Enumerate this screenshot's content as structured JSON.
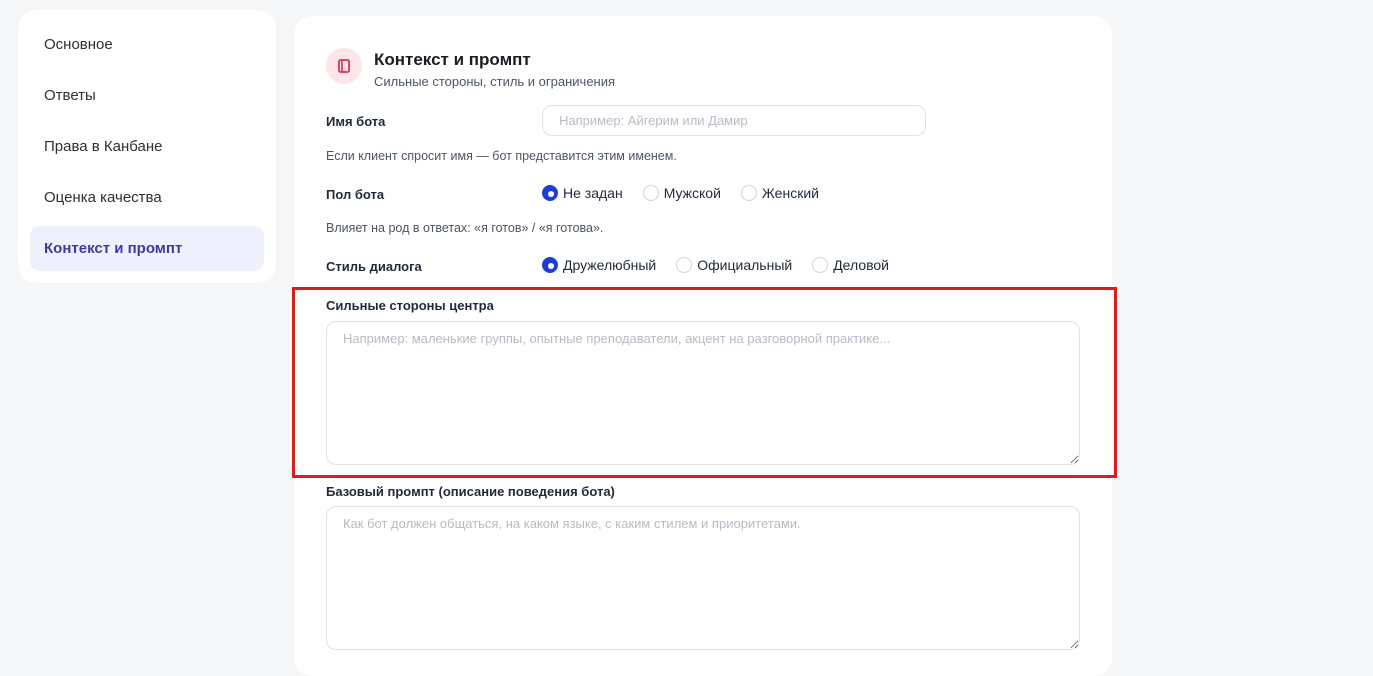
{
  "sidebar": {
    "items": [
      {
        "label": "Основное",
        "active": false
      },
      {
        "label": "Ответы",
        "active": false
      },
      {
        "label": "Права в Канбане",
        "active": false
      },
      {
        "label": "Оценка качества",
        "active": false
      },
      {
        "label": "Контекст и промпт",
        "active": true
      }
    ]
  },
  "section": {
    "icon": "book-icon",
    "title": "Контекст и промпт",
    "subtitle": "Сильные стороны, стиль и ограничения"
  },
  "bot_name": {
    "label": "Имя бота",
    "value": "",
    "placeholder": "Например: Айгерим или Дамир",
    "hint": "Если клиент спросит имя — бот представится этим именем."
  },
  "bot_gender": {
    "label": "Пол бота",
    "options": [
      "Не задан",
      "Мужской",
      "Женский"
    ],
    "selected": "Не задан",
    "hint": "Влияет на род в ответах: «я готов» / «я готова»."
  },
  "dialog_style": {
    "label": "Стиль диалога",
    "options": [
      "Дружелюбный",
      "Официальный",
      "Деловой"
    ],
    "selected": "Дружелюбный"
  },
  "strengths": {
    "label": "Сильные стороны центра",
    "value": "",
    "placeholder": "Например: маленькие группы, опытные преподаватели, акцент на разговорной практике..."
  },
  "base_prompt": {
    "label": "Базовый промпт (описание поведения бота)",
    "value": "",
    "placeholder": "Как бот должен общаться, на каком языке, с каким стилем и приоритетами."
  },
  "colors": {
    "accent": "#1d3fd8",
    "active_nav_bg": "#eef0fd",
    "active_nav_text": "#3f3b9c",
    "icon_bg": "#fde6ea",
    "icon_color": "#d6334f",
    "highlight": "#d71f1f"
  }
}
